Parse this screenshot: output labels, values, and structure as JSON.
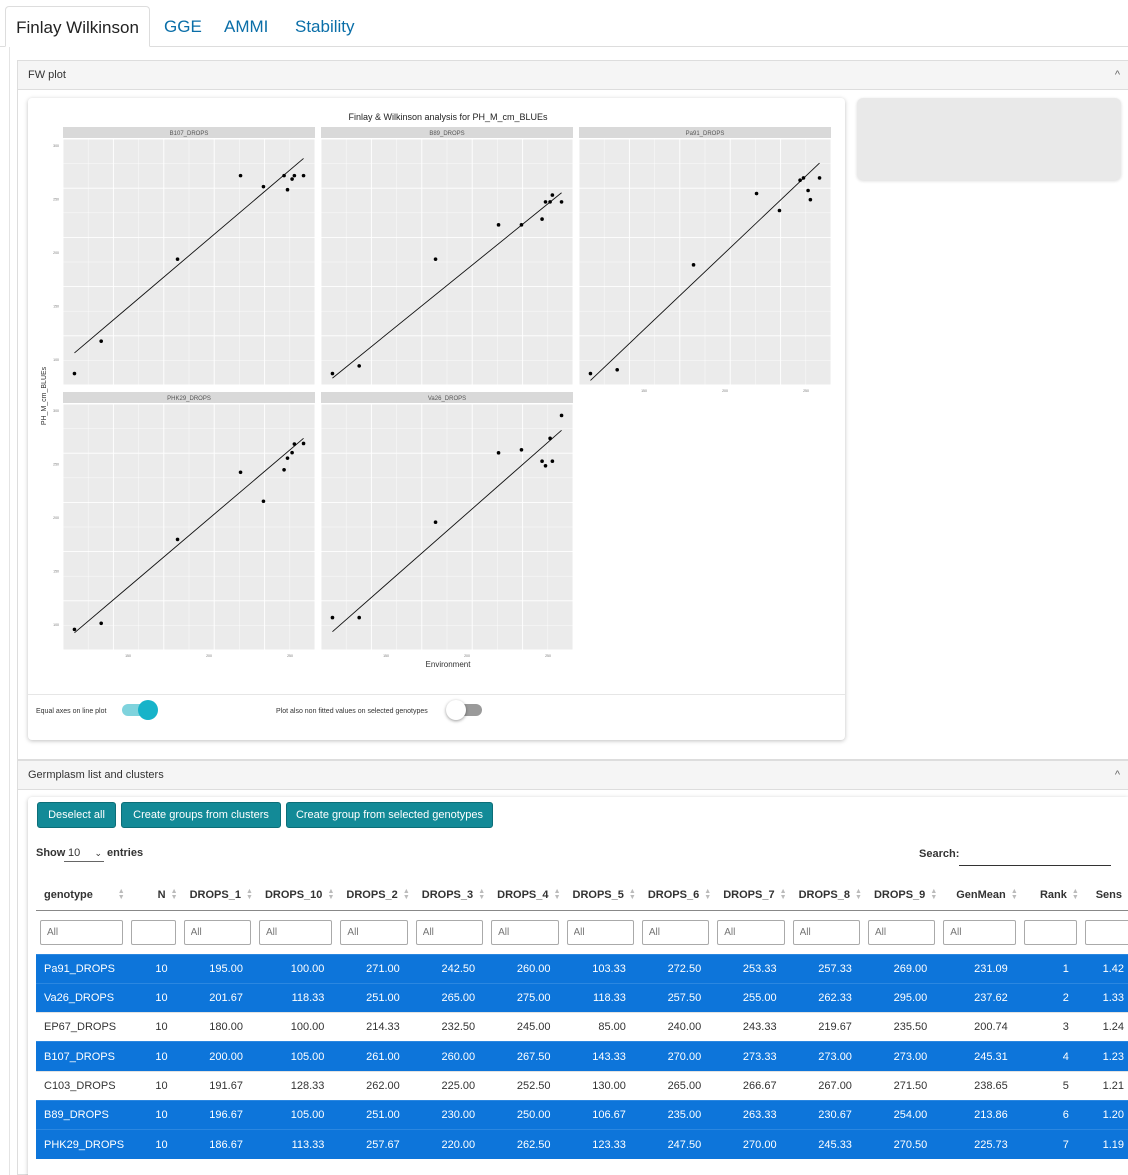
{
  "tabs": [
    {
      "label": "Finlay Wilkinson",
      "active": true
    },
    {
      "label": "GGE"
    },
    {
      "label": "AMMI"
    },
    {
      "label": "Stability"
    }
  ],
  "fw_panel": {
    "title": "FW plot"
  },
  "plot": {
    "title": "Finlay & Wilkinson analysis for PH_M_cm_BLUEs",
    "xlabel": "Environment",
    "ylabel": "PH_M_cm_BLUEs",
    "facets": [
      {
        "name": "B107_DROPS",
        "points": [
          [
            180,
            100
          ],
          [
            191.67,
            128.33
          ],
          [
            225,
            200
          ],
          [
            252.5,
            273
          ],
          [
            262.5,
            263.33
          ],
          [
            271.5,
            273
          ],
          [
            273,
            260.67
          ],
          [
            275,
            270
          ],
          [
            276,
            273
          ],
          [
            280,
            273
          ]
        ],
        "line": [
          [
            180,
            118
          ],
          [
            280,
            288
          ]
        ]
      },
      {
        "name": "B89_DROPS",
        "points": [
          [
            180,
            100
          ],
          [
            191.67,
            106.67
          ],
          [
            225,
            200
          ],
          [
            252.5,
            230
          ],
          [
            262.5,
            230
          ],
          [
            271.5,
            235
          ],
          [
            273,
            250
          ],
          [
            275,
            250
          ],
          [
            276,
            256
          ],
          [
            280,
            250
          ]
        ],
        "line": [
          [
            180,
            96
          ],
          [
            280,
            258
          ]
        ]
      },
      {
        "name": "Pa91_DROPS",
        "points": [
          [
            180,
            100
          ],
          [
            191.67,
            103.33
          ],
          [
            225,
            195
          ],
          [
            252.5,
            257.33
          ],
          [
            262.5,
            242.5
          ],
          [
            271.5,
            269
          ],
          [
            273,
            271
          ],
          [
            275,
            260
          ],
          [
            276,
            252
          ],
          [
            280,
            271
          ]
        ],
        "line": [
          [
            180,
            94
          ],
          [
            280,
            284
          ]
        ]
      },
      {
        "name": "PHK29_DROPS",
        "points": [
          [
            180,
            108
          ],
          [
            191.67,
            113.33
          ],
          [
            225,
            186.67
          ],
          [
            252.5,
            245.33
          ],
          [
            262.5,
            220
          ],
          [
            271.5,
            247.5
          ],
          [
            273,
            257.67
          ],
          [
            275,
            262.5
          ],
          [
            276,
            270
          ],
          [
            280,
            270.5
          ]
        ],
        "line": [
          [
            180,
            105
          ],
          [
            280,
            275
          ]
        ]
      },
      {
        "name": "Va26_DROPS",
        "points": [
          [
            180,
            118.33
          ],
          [
            191.67,
            118.33
          ],
          [
            225,
            201.67
          ],
          [
            252.5,
            262.33
          ],
          [
            262.5,
            265
          ],
          [
            271.5,
            255
          ],
          [
            273,
            251
          ],
          [
            275,
            275
          ],
          [
            276,
            255
          ],
          [
            280,
            295
          ]
        ],
        "line": [
          [
            180,
            106
          ],
          [
            280,
            282
          ]
        ]
      }
    ],
    "ytick_labels": [
      "300",
      "250",
      "200",
      "150",
      "100"
    ],
    "xtick_labels": [
      "150",
      "200",
      "250"
    ]
  },
  "toggles": {
    "equal_axes": {
      "label": "Equal axes on line plot",
      "on": true
    },
    "non_fitted": {
      "label": "Plot also non fitted values on selected genotypes",
      "on": false
    }
  },
  "germ_panel": {
    "title": "Germplasm list and clusters"
  },
  "buttons": {
    "deselect": "Deselect all",
    "groups_clusters": "Create groups from clusters",
    "group_selected": "Create group from selected genotypes"
  },
  "length": {
    "show": "Show",
    "value": "10",
    "entries": "entries"
  },
  "search": {
    "label": "Search:"
  },
  "columns": [
    "genotype",
    "N",
    "DROPS_1",
    "DROPS_10",
    "DROPS_2",
    "DROPS_3",
    "DROPS_4",
    "DROPS_5",
    "DROPS_6",
    "DROPS_7",
    "DROPS_8",
    "DROPS_9",
    "GenMean",
    "Rank",
    "Sens"
  ],
  "filter_placeholder": "All",
  "rows": [
    {
      "sel": true,
      "cells": [
        "Pa91_DROPS",
        "10",
        "195.00",
        "100.00",
        "271.00",
        "242.50",
        "260.00",
        "103.33",
        "272.50",
        "253.33",
        "257.33",
        "269.00",
        "231.09",
        "1",
        "1.42"
      ]
    },
    {
      "sel": true,
      "cells": [
        "Va26_DROPS",
        "10",
        "201.67",
        "118.33",
        "251.00",
        "265.00",
        "275.00",
        "118.33",
        "257.50",
        "255.00",
        "262.33",
        "295.00",
        "237.62",
        "2",
        "1.33"
      ]
    },
    {
      "sel": false,
      "cells": [
        "EP67_DROPS",
        "10",
        "180.00",
        "100.00",
        "214.33",
        "232.50",
        "245.00",
        "85.00",
        "240.00",
        "243.33",
        "219.67",
        "235.50",
        "200.74",
        "3",
        "1.24"
      ]
    },
    {
      "sel": true,
      "cells": [
        "B107_DROPS",
        "10",
        "200.00",
        "105.00",
        "261.00",
        "260.00",
        "267.50",
        "143.33",
        "270.00",
        "273.33",
        "273.00",
        "273.00",
        "245.31",
        "4",
        "1.23"
      ]
    },
    {
      "sel": false,
      "cells": [
        "C103_DROPS",
        "10",
        "191.67",
        "128.33",
        "262.00",
        "225.00",
        "252.50",
        "130.00",
        "265.00",
        "266.67",
        "267.00",
        "271.50",
        "238.65",
        "5",
        "1.21"
      ]
    },
    {
      "sel": true,
      "cells": [
        "B89_DROPS",
        "10",
        "196.67",
        "105.00",
        "251.00",
        "230.00",
        "250.00",
        "106.67",
        "235.00",
        "263.33",
        "230.67",
        "254.00",
        "213.86",
        "6",
        "1.20"
      ]
    },
    {
      "sel": true,
      "cells": [
        "PHK29_DROPS",
        "10",
        "186.67",
        "113.33",
        "257.67",
        "220.00",
        "262.50",
        "123.33",
        "247.50",
        "270.00",
        "245.33",
        "270.50",
        "225.73",
        "7",
        "1.19"
      ]
    }
  ]
}
